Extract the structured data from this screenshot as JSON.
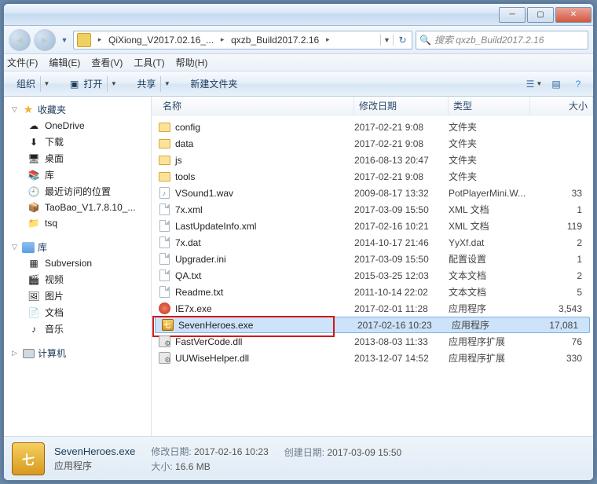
{
  "breadcrumb": {
    "seg1": "QiXiong_V2017.02.16_...",
    "seg2": "qxzb_Build2017.2.16"
  },
  "search": {
    "placeholder": "搜索 qxzb_Build2017.2.16"
  },
  "menubar": {
    "file": "文件(F)",
    "edit": "编辑(E)",
    "view": "查看(V)",
    "tools": "工具(T)",
    "help": "帮助(H)"
  },
  "toolbar": {
    "organize": "组织",
    "open": "打开",
    "share": "共享",
    "newfolder": "新建文件夹"
  },
  "sidebar": {
    "favorites": "收藏夹",
    "fav_items": [
      "OneDrive",
      "下载",
      "桌面",
      "库",
      "最近访问的位置",
      "TaoBao_V1.7.8.10_...",
      "tsq"
    ],
    "libraries": "库",
    "lib_items": [
      "Subversion",
      "视频",
      "图片",
      "文档",
      "音乐"
    ],
    "computer": "计算机"
  },
  "columns": {
    "name": "名称",
    "date": "修改日期",
    "type": "类型",
    "size": "大小"
  },
  "files": [
    {
      "icon": "fold",
      "name": "config",
      "date": "2017-02-21 9:08",
      "type": "文件夹",
      "size": ""
    },
    {
      "icon": "fold",
      "name": "data",
      "date": "2017-02-21 9:08",
      "type": "文件夹",
      "size": ""
    },
    {
      "icon": "fold",
      "name": "js",
      "date": "2016-08-13 20:47",
      "type": "文件夹",
      "size": ""
    },
    {
      "icon": "fold",
      "name": "tools",
      "date": "2017-02-21 9:08",
      "type": "文件夹",
      "size": ""
    },
    {
      "icon": "wav",
      "name": "VSound1.wav",
      "date": "2009-08-17 13:32",
      "type": "PotPlayerMini.W...",
      "size": "33"
    },
    {
      "icon": "file",
      "name": "7x.xml",
      "date": "2017-03-09 15:50",
      "type": "XML 文档",
      "size": "1"
    },
    {
      "icon": "file",
      "name": "LastUpdateInfo.xml",
      "date": "2017-02-16 10:21",
      "type": "XML 文档",
      "size": "119"
    },
    {
      "icon": "file",
      "name": "7x.dat",
      "date": "2014-10-17 21:46",
      "type": "YyXf.dat",
      "size": "2"
    },
    {
      "icon": "file",
      "name": "Upgrader.ini",
      "date": "2017-03-09 15:50",
      "type": "配置设置",
      "size": "1"
    },
    {
      "icon": "file",
      "name": "QA.txt",
      "date": "2015-03-25 12:03",
      "type": "文本文档",
      "size": "2"
    },
    {
      "icon": "file",
      "name": "Readme.txt",
      "date": "2011-10-14 22:02",
      "type": "文本文档",
      "size": "5"
    },
    {
      "icon": "red",
      "name": "IE7x.exe",
      "date": "2017-02-01 11:28",
      "type": "应用程序",
      "size": "3,543"
    },
    {
      "icon": "exe",
      "name": "SevenHeroes.exe",
      "date": "2017-02-16 10:23",
      "type": "应用程序",
      "size": "17,081",
      "selected": true,
      "hl": true
    },
    {
      "icon": "dll",
      "name": "FastVerCode.dll",
      "date": "2013-08-03 11:33",
      "type": "应用程序扩展",
      "size": "76"
    },
    {
      "icon": "dll",
      "name": "UUWiseHelper.dll",
      "date": "2013-12-07 14:52",
      "type": "应用程序扩展",
      "size": "330"
    }
  ],
  "status": {
    "title": "SevenHeroes.exe",
    "sub": "应用程序",
    "l1_label": "修改日期:",
    "l1_val": "2017-02-16 10:23",
    "l2_label": "大小:",
    "l2_val": "16.6 MB",
    "r1_label": "创建日期:",
    "r1_val": "2017-03-09 15:50"
  }
}
